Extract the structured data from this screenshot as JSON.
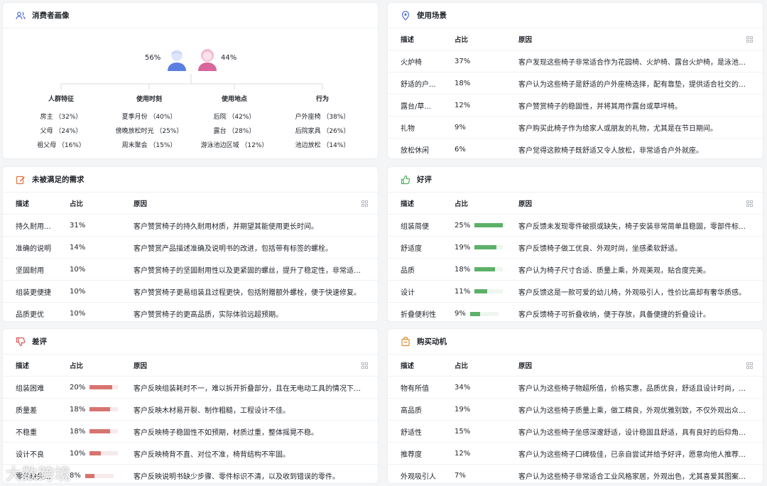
{
  "consumer": {
    "title": "消费者画像",
    "male_pct": "56%",
    "female_pct": "44%",
    "columns": [
      {
        "title": "人群特征",
        "values": [
          "房主 （32%）",
          "父母 （24%）",
          "祖父母 （16%）"
        ]
      },
      {
        "title": "使用时刻",
        "values": [
          "夏季月份 （40%）",
          "傍晚放松时光 （25%）",
          "周末聚会 （15%）"
        ]
      },
      {
        "title": "使用地点",
        "values": [
          "后院 （42%）",
          "露台 （28%）",
          "游泳池边区域 （12%）"
        ]
      },
      {
        "title": "行为",
        "values": [
          "户外座椅 （38%）",
          "后院家具 （26%）",
          "池边放松 （14%）"
        ]
      }
    ]
  },
  "scenes": {
    "title": "使用场景",
    "headers": [
      "描述",
      "占比",
      "原因"
    ],
    "rows": [
      {
        "desc": "火炉椅",
        "pct": "37%",
        "reason": "客户发现这些椅子非常适合作为花园椅、火炉椅、露台火炉椅，是泳池甲板..."
      },
      {
        "desc": "舒适的户...",
        "pct": "18%",
        "reason": "客户认为这些椅子是舒适的户外座椅选择，配有靠垫，提供适合社交的户外..."
      },
      {
        "desc": "露台/草...",
        "pct": "12%",
        "reason": "客户赞赏椅子的稳固性，并将其用作露台或草坪椅。"
      },
      {
        "desc": "礼物",
        "pct": "9%",
        "reason": "客户购买此椅子作为给家人或朋友的礼物，尤其是在节日期间。"
      },
      {
        "desc": "放松休闲",
        "pct": "6%",
        "reason": "客户觉得这款椅子既舒适又令人放松，非常适合户外就座。"
      }
    ]
  },
  "unmet": {
    "title": "未被满足的需求",
    "headers": [
      "描述",
      "占比",
      "原因"
    ],
    "rows": [
      {
        "desc": "持久耐用...",
        "pct": "31%",
        "reason": "客户赞赏椅子的持久耐用材质，并期望其能使用更长时间。"
      },
      {
        "desc": "准确的说明",
        "pct": "14%",
        "reason": "客户赞赏产品描述准确及说明书的改进，包括带有标签的螺栓。"
      },
      {
        "desc": "坚固耐用",
        "pct": "10%",
        "reason": "客户赞赏椅子的坚固耐用性以及更紧固的螺丝，提升了稳定性，非常适合户..."
      },
      {
        "desc": "组装更便捷",
        "pct": "10%",
        "reason": "客户赞赏椅子更易组装且过程更快，包括附赠额外螺栓，便于快速修复。"
      },
      {
        "desc": "品质更优",
        "pct": "10%",
        "reason": "客户赞赏椅子的更高品质，实际体验远超预期。"
      }
    ]
  },
  "positive": {
    "title": "好评",
    "headers": [
      "描述",
      "占比",
      "原因"
    ],
    "rows": [
      {
        "desc": "组装简便",
        "pct": "25%",
        "share": 0.25,
        "reason": "客户反馈未发现零件破损或缺失，椅子安装非常简单且稳固，零部件标识清..."
      },
      {
        "desc": "舒适度",
        "pct": "19%",
        "share": 0.19,
        "reason": "客户反馈椅子做工优良、外观时尚，坐感柔软舒适。"
      },
      {
        "desc": "品质",
        "pct": "18%",
        "share": 0.18,
        "reason": "客户认为椅子尺寸合适、质量上乘，外观美观，贴合度完美。"
      },
      {
        "desc": "设计",
        "pct": "11%",
        "share": 0.11,
        "reason": "客户反馈这是一款可爱的幼儿椅，外观吸引人，性价比高却有奢华质感。"
      },
      {
        "desc": "折叠便利性",
        "pct": "9%",
        "share": 0.09,
        "reason": "客户反馈椅子可折叠收纳，便于存放，具备便捷的折叠设计。"
      }
    ]
  },
  "negative": {
    "title": "差评",
    "headers": [
      "描述",
      "占比",
      "原因"
    ],
    "rows": [
      {
        "desc": "组装困难",
        "pct": "20%",
        "share": 0.2,
        "reason": "客户反映组装耗时不一，难以拆开折叠部分，且在无电动工具的情况下安装..."
      },
      {
        "desc": "质量差",
        "pct": "18%",
        "share": 0.18,
        "reason": "客户反映木材易开裂、制作粗糙，工程设计不佳。"
      },
      {
        "desc": "不稳重",
        "pct": "18%",
        "share": 0.18,
        "reason": "客户反映椅子稳固性不如预期，材质过重，整体摇晃不稳。"
      },
      {
        "desc": "设计不良",
        "pct": "10%",
        "share": 0.1,
        "reason": "客户反映椅背不直、对位不准，椅背结构不牢固。"
      },
      {
        "desc": "零件缺失...",
        "pct": "8%",
        "share": 0.08,
        "reason": "客户反映说明书缺少步骤、零件标识不清，以及收到错误的零件。"
      }
    ]
  },
  "motive": {
    "title": "购买动机",
    "headers": [
      "描述",
      "占比",
      "原因"
    ],
    "rows": [
      {
        "desc": "物有所值",
        "pct": "34%",
        "reason": "客户认为这些椅子物超所值，价格实惠，品质优良，舒适且设计时尚，以极..."
      },
      {
        "desc": "高品质",
        "pct": "19%",
        "reason": "客户认为这些椅子质量上乘，做工精良，外观优雅别致，不仅外观出众，而..."
      },
      {
        "desc": "舒适性",
        "pct": "15%",
        "reason": "客户认为这些椅子坐感深邃舒适，设计稳固且舒适，具有良好的后仰角度，..."
      },
      {
        "desc": "推荐度",
        "pct": "12%",
        "reason": "客户认为这些椅子口碑极佳，已亲自尝试并给予好评，愿意向他人推荐，并..."
      },
      {
        "desc": "外观吸引人",
        "pct": "7%",
        "reason": "客户认为这些椅子非常适合工业风格家居，外观出色，尤其喜爱其图案设计。"
      }
    ]
  },
  "watermark": "大数跨境",
  "colors": {
    "male": "#5b7fe0",
    "female": "#d8669a",
    "positive_bar": "#5cb168",
    "negative_bar": "#d87470"
  }
}
